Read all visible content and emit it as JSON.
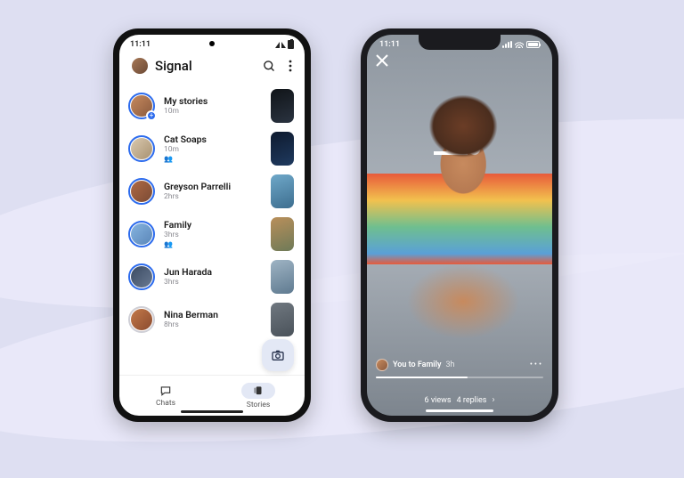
{
  "left": {
    "statusbar": {
      "time": "11:11"
    },
    "header": {
      "title": "Signal"
    },
    "stories": [
      {
        "name": "My stories",
        "time": "10m",
        "my": true,
        "ring": "blue",
        "avatar_bg": "linear-gradient(135deg,#c78a5e,#8a5a3e)",
        "thumb_bg": "linear-gradient(160deg,#101418,#2a3340)"
      },
      {
        "name": "Cat Soaps",
        "time": "10m",
        "group": true,
        "ring": "blue",
        "avatar_bg": "linear-gradient(135deg,#d9c9b0,#a89170)",
        "thumb_bg": "linear-gradient(160deg,#0e1a2e,#1f3a5f)"
      },
      {
        "name": "Greyson Parrelli",
        "time": "2hrs",
        "ring": "blue",
        "avatar_bg": "linear-gradient(135deg,#b06a46,#7a4a34)",
        "thumb_bg": "linear-gradient(160deg,#6fa8c9,#3d6e8f)"
      },
      {
        "name": "Family",
        "time": "3hrs",
        "group": true,
        "ring": "blue",
        "avatar_bg": "linear-gradient(135deg,#86b4e0,#5a86b8)",
        "thumb_bg": "linear-gradient(160deg,#b98f5a,#6e7a58)"
      },
      {
        "name": "Jun Harada",
        "time": "3hrs",
        "ring": "blue",
        "avatar_bg": "linear-gradient(135deg,#3a4a62,#6a7a92)",
        "thumb_bg": "linear-gradient(160deg,#9fb4c4,#5f7a90)"
      },
      {
        "name": "Nina Berman",
        "time": "8hrs",
        "ring": "gray",
        "avatar_bg": "linear-gradient(135deg,#c47a4a,#8a4a2e)",
        "thumb_bg": "linear-gradient(160deg,#707880,#4a525a)"
      }
    ],
    "nav": {
      "chats": "Chats",
      "stories": "Stories"
    }
  },
  "right": {
    "statusbar": {
      "time": "11:11"
    },
    "story": {
      "author_line": "You to Family",
      "age": "3h",
      "views_label": "6 views",
      "replies_label": "4 replies"
    }
  }
}
